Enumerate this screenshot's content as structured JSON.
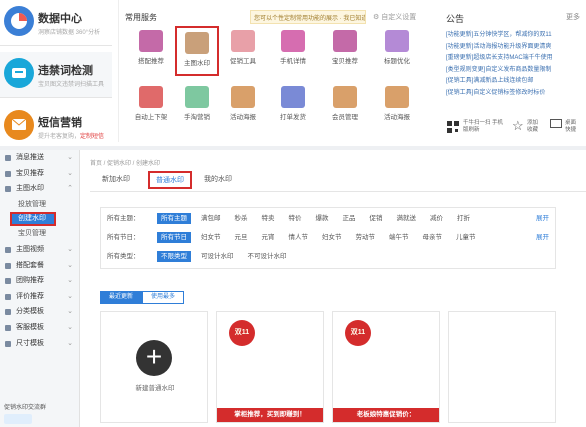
{
  "cards": [
    {
      "title": "数据中心",
      "subtitle": "洞察店铺数据 360°分析",
      "color": "#3b7fd6",
      "icon": "pie-chart-icon"
    },
    {
      "title": "违禁词检测",
      "subtitle": "宝贝图文违禁词扫描工具",
      "color": "#19a7d9",
      "icon": "scan-icon"
    },
    {
      "title": "短信营销",
      "subtitle": "提升老客复购，",
      "highlight": "定制短信",
      "color": "#e8891e",
      "icon": "sms-icon"
    }
  ],
  "services": {
    "title": "常用服务",
    "note": "您可以个性定制常用功能的展示 · 我已知道",
    "config": "自定义设置",
    "tiles": [
      {
        "label": "搭配推荐",
        "icon": "shop-icon",
        "color": "#c46aa8"
      },
      {
        "label": "主图水印",
        "icon": "bookmark-icon",
        "color": "#c9a07a",
        "selected": true
      },
      {
        "label": "促销工具",
        "icon": "sale-tag-icon",
        "color": "#e8a0a8"
      },
      {
        "label": "手机详情",
        "icon": "mobile-icon",
        "color": "#d66db0"
      },
      {
        "label": "宝贝推荐",
        "icon": "bag-icon",
        "color": "#c46aa8"
      },
      {
        "label": "标题优化",
        "icon": "check-icon",
        "color": "#b48ad6"
      },
      {
        "label": "自动上下架",
        "icon": "updown-icon",
        "color": "#e06a6a"
      },
      {
        "label": "手淘营销",
        "icon": "plane-icon",
        "color": "#7ec8a0"
      },
      {
        "label": "活动海报",
        "icon": "image-icon",
        "color": "#d9a06a"
      },
      {
        "label": "打单发货",
        "icon": "printer-icon",
        "color": "#7a8ad6"
      },
      {
        "label": "会员管理",
        "icon": "member-icon",
        "color": "#d9a06a"
      },
      {
        "label": "活动海报",
        "icon": "image2-icon",
        "color": "#d9a06a"
      }
    ]
  },
  "announcements": {
    "title": "公告",
    "more": "更多",
    "items": [
      "[功能更新]五分钟快学区，帮减你的双11",
      "[功能更新]活动海报功能升级界面更清爽",
      "[重磅更新]超级店长支持MAC端千牛使用",
      "[类型规则变更]自定义发布商品数量限制",
      "[促销工具]满减新品上线连续包邮",
      "[促销工具]自定义促销标签修改时标价"
    ],
    "footer": [
      {
        "label": "千牛扫一扫 手机版刷新",
        "icon": "qr-icon"
      },
      {
        "label": "添加 收藏",
        "icon": "star-icon"
      },
      {
        "label": "桌面 快捷",
        "icon": "desktop-icon"
      }
    ]
  },
  "menu": {
    "items": [
      {
        "label": "消息推送",
        "type": "item"
      },
      {
        "label": "宝贝推荐",
        "type": "item"
      },
      {
        "label": "主图水印",
        "type": "item",
        "open": true
      },
      {
        "label": "投放管理",
        "type": "sub"
      },
      {
        "label": "创建水印",
        "type": "active"
      },
      {
        "label": "宝贝管理",
        "type": "sub"
      },
      {
        "label": "主图视频",
        "type": "item"
      },
      {
        "label": "搭配套餐",
        "type": "item"
      },
      {
        "label": "团购推荐",
        "type": "item"
      },
      {
        "label": "评价推荐",
        "type": "item"
      },
      {
        "label": "分类模板",
        "type": "item"
      },
      {
        "label": "客服模板",
        "type": "item"
      },
      {
        "label": "尺寸模板",
        "type": "item"
      }
    ],
    "footer": "促销水印交流群"
  },
  "breadcrumb": "首页  /  促销水印  /  创建水印",
  "tabs": [
    {
      "label": "新加水印",
      "selected": false
    },
    {
      "label": "普通水印",
      "selected": true
    },
    {
      "label": "我的水印",
      "selected": false
    }
  ],
  "filters": [
    {
      "label": "所有主题：",
      "chips": [
        "所有主题",
        "满包邮",
        "秒杀",
        "特卖",
        "特价",
        "爆款",
        "正品",
        "促销",
        "满就送",
        "减价",
        "打折"
      ],
      "expand": "展开"
    },
    {
      "label": "所有节日：",
      "chips": [
        "所有节日",
        "妇女节",
        "元旦",
        "元宵",
        "情人节",
        "妇女节",
        "劳动节",
        "端午节",
        "母亲节",
        "儿童节"
      ],
      "expand": "展开"
    },
    {
      "label": "所有类型：",
      "chips": [
        "不限类型",
        "可设计水印",
        "不可设计水印"
      ],
      "expand": ""
    }
  ],
  "sort": {
    "options": [
      "最近更新",
      "使用最多"
    ]
  },
  "templates": {
    "new_label": "新建普通水印",
    "items": [
      {
        "badge": "双11",
        "strip": "掌柜推荐，买到即赚到！"
      },
      {
        "badge": "双11",
        "strip": "老板娘特惠促销价："
      }
    ]
  }
}
